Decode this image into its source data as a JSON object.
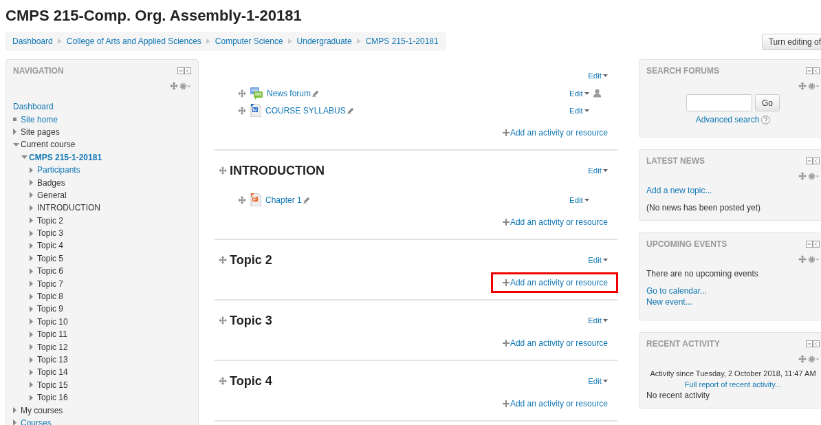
{
  "page_title": "CMPS 215-Comp. Org. Assembly-1-20181",
  "breadcrumb": [
    "Dashboard",
    "College of Arts and Applied Sciences",
    "Computer Science",
    "Undergraduate",
    "CMPS 215-1-20181"
  ],
  "editing_button": "Turn editing of",
  "navigation": {
    "title": "NAVIGATION",
    "items": [
      {
        "label": "Dashboard",
        "kind": "root",
        "link": true,
        "active": false
      },
      {
        "label": "Site home",
        "kind": "leaf",
        "link": true,
        "active": false
      },
      {
        "label": "Site pages",
        "kind": "branch",
        "expanded": false,
        "link": false,
        "active": false
      },
      {
        "label": "Current course",
        "kind": "branch",
        "expanded": true,
        "link": false,
        "active": false,
        "children": [
          {
            "label": "CMPS 215-1-20181",
            "kind": "branch",
            "expanded": true,
            "link": true,
            "active": true,
            "children": [
              {
                "label": "Participants",
                "kind": "branch",
                "expanded": false,
                "link": true,
                "active": false
              },
              {
                "label": "Badges",
                "kind": "branch",
                "expanded": false,
                "link": false,
                "active": false
              },
              {
                "label": "General",
                "kind": "branch",
                "expanded": false,
                "link": false,
                "active": false
              },
              {
                "label": "INTRODUCTION",
                "kind": "branch",
                "expanded": false,
                "link": false,
                "active": false
              },
              {
                "label": "Topic 2",
                "kind": "branch",
                "expanded": false,
                "link": false,
                "active": false
              },
              {
                "label": "Topic 3",
                "kind": "branch",
                "expanded": false,
                "link": false,
                "active": false
              },
              {
                "label": "Topic 4",
                "kind": "branch",
                "expanded": false,
                "link": false,
                "active": false
              },
              {
                "label": "Topic 5",
                "kind": "branch",
                "expanded": false,
                "link": false,
                "active": false
              },
              {
                "label": "Topic 6",
                "kind": "branch",
                "expanded": false,
                "link": false,
                "active": false
              },
              {
                "label": "Topic 7",
                "kind": "branch",
                "expanded": false,
                "link": false,
                "active": false
              },
              {
                "label": "Topic 8",
                "kind": "branch",
                "expanded": false,
                "link": false,
                "active": false
              },
              {
                "label": "Topic 9",
                "kind": "branch",
                "expanded": false,
                "link": false,
                "active": false
              },
              {
                "label": "Topic 10",
                "kind": "branch",
                "expanded": false,
                "link": false,
                "active": false
              },
              {
                "label": "Topic 11",
                "kind": "branch",
                "expanded": false,
                "link": false,
                "active": false
              },
              {
                "label": "Topic 12",
                "kind": "branch",
                "expanded": false,
                "link": false,
                "active": false
              },
              {
                "label": "Topic 13",
                "kind": "branch",
                "expanded": false,
                "link": false,
                "active": false
              },
              {
                "label": "Topic 14",
                "kind": "branch",
                "expanded": false,
                "link": false,
                "active": false
              },
              {
                "label": "Topic 15",
                "kind": "branch",
                "expanded": false,
                "link": false,
                "active": false
              },
              {
                "label": "Topic 16",
                "kind": "branch",
                "expanded": false,
                "link": false,
                "active": false
              }
            ]
          }
        ]
      },
      {
        "label": "My courses",
        "kind": "branch",
        "expanded": false,
        "link": false,
        "active": false
      },
      {
        "label": "Courses",
        "kind": "branch",
        "expanded": false,
        "link": true,
        "active": false
      }
    ]
  },
  "sections": [
    {
      "edit": "Edit",
      "activities": [
        {
          "name": "News forum",
          "kind": "forum",
          "edit": "Edit",
          "group_icon": true
        },
        {
          "name": "COURSE SYLLABUS",
          "kind": "word",
          "edit": "Edit",
          "group_icon": false
        }
      ],
      "add": "Add an activity or resource",
      "highlighted": false
    },
    {
      "title": "INTRODUCTION",
      "edit": "Edit",
      "activities": [
        {
          "name": "Chapter 1",
          "kind": "powerpoint",
          "edit": "Edit",
          "group_icon": false
        }
      ],
      "add": "Add an activity or resource",
      "highlighted": false
    },
    {
      "title": "Topic 2",
      "edit": "Edit",
      "add": "Add an activity or resource",
      "highlighted": true
    },
    {
      "title": "Topic 3",
      "edit": "Edit",
      "add": "Add an activity or resource",
      "highlighted": false
    },
    {
      "title": "Topic 4",
      "edit": "Edit",
      "add": "Add an activity or resource",
      "highlighted": false
    }
  ],
  "blocks": [
    {
      "kind": "search",
      "title": "SEARCH FORUMS",
      "button": "Go",
      "link": "Advanced search"
    },
    {
      "kind": "list",
      "title": "LATEST NEWS",
      "paragraphs": [
        [
          {
            "text": "Add a new topic...",
            "link": true,
            "center": false
          }
        ],
        [
          {
            "text": "(No news has been posted yet)",
            "link": false,
            "center": false
          }
        ]
      ]
    },
    {
      "kind": "list",
      "title": "UPCOMING EVENTS",
      "paragraphs": [
        [
          {
            "text": "There are no upcoming events",
            "link": false,
            "center": false
          }
        ],
        [
          {
            "text": "Go to calendar...",
            "link": true,
            "center": false
          },
          {
            "text": "New event...",
            "link": true,
            "center": false
          }
        ]
      ]
    },
    {
      "kind": "list",
      "title": "RECENT ACTIVITY",
      "paragraphs": [
        [
          {
            "text": "Activity since Tuesday, 2 October 2018, 11:47 AM",
            "link": false,
            "center": true
          },
          {
            "text": "Full report of recent activity...",
            "link": true,
            "center": true
          },
          {
            "text": "No recent activity",
            "link": false,
            "center": false
          }
        ]
      ]
    }
  ]
}
